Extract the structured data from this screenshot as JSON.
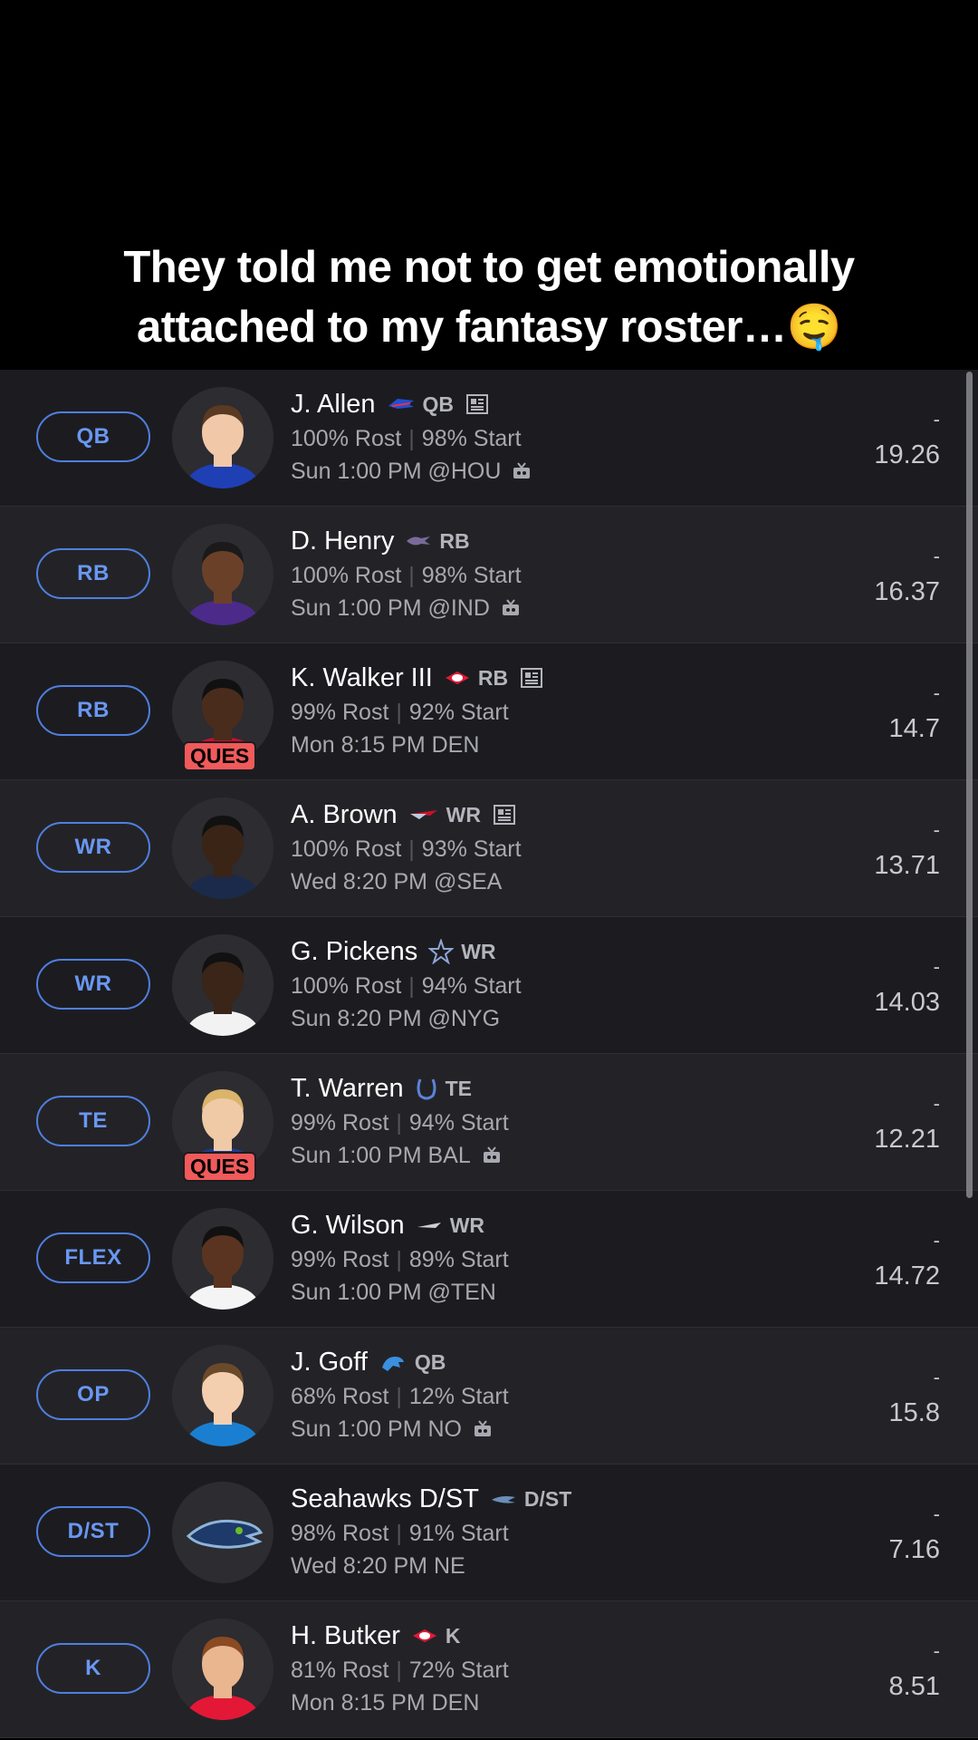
{
  "caption": {
    "line1": "They told me not to get emotionally",
    "line2": "attached to my fantasy roster…🤤"
  },
  "accent_color": "#4f7fe0",
  "status_color": "#f05a5a",
  "roster": [
    {
      "slot": "QB",
      "name": "J. Allen",
      "team_icon": "bills-logo-icon",
      "pos": "QB",
      "news": true,
      "rost": "100% Rost",
      "start": "98% Start",
      "game": "Sun 1:00 PM @HOU",
      "tv": true,
      "status": "",
      "proj_top": "-",
      "proj": "19.26"
    },
    {
      "slot": "RB",
      "name": "D. Henry",
      "team_icon": "ravens-logo-icon",
      "pos": "RB",
      "news": false,
      "rost": "100% Rost",
      "start": "98% Start",
      "game": "Sun 1:00 PM @IND",
      "tv": true,
      "status": "",
      "proj_top": "-",
      "proj": "16.37"
    },
    {
      "slot": "RB",
      "name": "K. Walker III",
      "team_icon": "chiefs-logo-icon",
      "pos": "RB",
      "news": true,
      "rost": "99% Rost",
      "start": "92% Start",
      "game": "Mon 8:15 PM DEN",
      "tv": false,
      "status": "QUES",
      "proj_top": "-",
      "proj": "14.7"
    },
    {
      "slot": "WR",
      "name": "A. Brown",
      "team_icon": "patriots-logo-icon",
      "pos": "WR",
      "news": true,
      "rost": "100% Rost",
      "start": "93% Start",
      "game": "Wed 8:20 PM @SEA",
      "tv": false,
      "status": "",
      "proj_top": "-",
      "proj": "13.71"
    },
    {
      "slot": "WR",
      "name": "G. Pickens",
      "team_icon": "cowboys-logo-icon",
      "pos": "WR",
      "news": false,
      "rost": "100% Rost",
      "start": "94% Start",
      "game": "Sun 8:20 PM @NYG",
      "tv": false,
      "status": "",
      "proj_top": "-",
      "proj": "14.03"
    },
    {
      "slot": "TE",
      "name": "T. Warren",
      "team_icon": "colts-logo-icon",
      "pos": "TE",
      "news": false,
      "rost": "99% Rost",
      "start": "94% Start",
      "game": "Sun 1:00 PM BAL",
      "tv": true,
      "status": "QUES",
      "proj_top": "-",
      "proj": "12.21"
    },
    {
      "slot": "FLEX",
      "name": "G. Wilson",
      "team_icon": "jets-logo-icon",
      "pos": "WR",
      "news": false,
      "rost": "99% Rost",
      "start": "89% Start",
      "game": "Sun 1:00 PM @TEN",
      "tv": false,
      "status": "",
      "proj_top": "-",
      "proj": "14.72"
    },
    {
      "slot": "OP",
      "name": "J. Goff",
      "team_icon": "lions-logo-icon",
      "pos": "QB",
      "news": false,
      "rost": "68% Rost",
      "start": "12% Start",
      "game": "Sun 1:00 PM NO",
      "tv": true,
      "status": "",
      "proj_top": "-",
      "proj": "15.8"
    },
    {
      "slot": "D/ST",
      "name": "Seahawks D/ST",
      "team_icon": "seahawks-logo-icon",
      "pos": "D/ST",
      "news": false,
      "rost": "98% Rost",
      "start": "91% Start",
      "game": "Wed 8:20 PM NE",
      "tv": false,
      "status": "",
      "proj_top": "-",
      "proj": "7.16"
    },
    {
      "slot": "K",
      "name": "H. Butker",
      "team_icon": "chiefs-logo-icon",
      "pos": "K",
      "news": false,
      "rost": "81% Rost",
      "start": "72% Start",
      "game": "Mon 8:15 PM DEN",
      "tv": false,
      "status": "",
      "proj_top": "-",
      "proj": "8.51"
    }
  ]
}
